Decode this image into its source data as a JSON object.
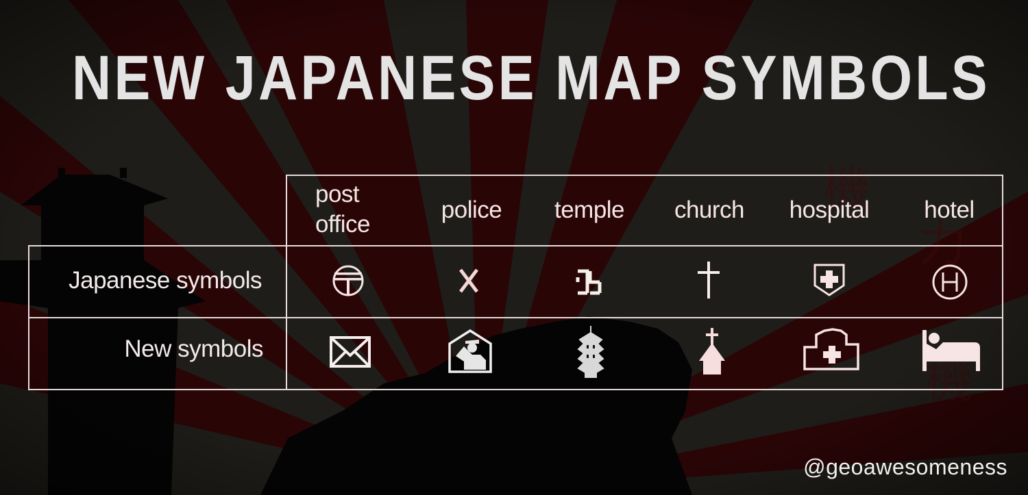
{
  "title": "NEW JAPANESE MAP SYMBOLS",
  "columns": [
    {
      "label_line1": "post",
      "label_line2": "office"
    },
    {
      "label_line1": "police",
      "label_line2": ""
    },
    {
      "label_line1": "temple",
      "label_line2": ""
    },
    {
      "label_line1": "church",
      "label_line2": ""
    },
    {
      "label_line1": "hospital",
      "label_line2": ""
    },
    {
      "label_line1": "hotel",
      "label_line2": ""
    }
  ],
  "rows": [
    {
      "label": "Japanese symbols",
      "icons": [
        "post-office-symbol-icon",
        "police-crossed-batons-icon",
        "temple-manji-icon",
        "church-cross-icon",
        "hospital-shield-cross-icon",
        "hotel-circled-h-icon"
      ]
    },
    {
      "label": "New symbols",
      "icons": [
        "envelope-icon",
        "saluting-officer-icon",
        "pagoda-icon",
        "chapel-icon",
        "hospital-building-icon",
        "bed-icon"
      ]
    }
  ],
  "credit": "@geoawesomeness",
  "colors": {
    "background": "#1d1b17",
    "ray_red": "#2a0506",
    "text": "#e4e4e4",
    "icon_fill": "#f7e4e4"
  }
}
